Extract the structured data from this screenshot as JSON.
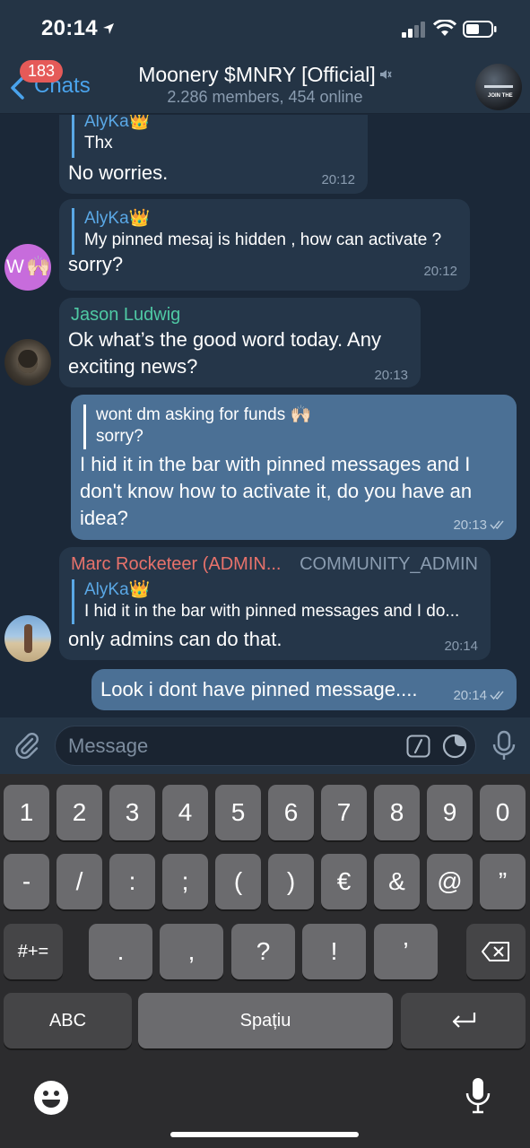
{
  "status_bar": {
    "time": "20:14"
  },
  "header": {
    "back_label": "Chats",
    "unread_count": "183",
    "title": "Moonery $MNRY [Official]",
    "subtitle": "2.286 members, 454 online",
    "avatar_text": "JOIN THE"
  },
  "messages": [
    {
      "reply_name": "AlyKa👑",
      "reply_text": "Thx",
      "text": "No worries.",
      "time": "20:12"
    },
    {
      "reply_name": "AlyKa👑",
      "reply_text": "My pinned mesaj is hidden , how can activate ?",
      "text": "sorry?",
      "time": "20:12",
      "avatar_letter": "W",
      "avatar_emoji": "🙌🏻"
    },
    {
      "sender": "Jason Ludwig",
      "sender_color": "#4fc9a4",
      "text": "Ok what’s the good word today. Any exciting news?",
      "time": "20:13"
    },
    {
      "reply_name": "wont dm asking for funds 🙌🏻",
      "reply_text": "sorry?",
      "text": "I hid it in the bar with pinned messages and I don't know how to activate it, do you have an idea?",
      "time": "20:13",
      "outgoing": true
    },
    {
      "sender": "Marc Rocketeer (ADMIN...",
      "sender_color": "#e8726b",
      "role": "COMMUNITY_ADMIN",
      "reply_name": "AlyKa👑",
      "reply_text": "I hid it in the bar with pinned messages and I do...",
      "text": "only admins can do that.",
      "time": "20:14"
    },
    {
      "text": "Look i dont have pinned message....",
      "time": "20:14",
      "outgoing": true
    }
  ],
  "composer": {
    "placeholder": "Message"
  },
  "keyboard": {
    "row1": [
      "1",
      "2",
      "3",
      "4",
      "5",
      "6",
      "7",
      "8",
      "9",
      "0"
    ],
    "row2": [
      "-",
      "/",
      ":",
      ";",
      "(",
      ")",
      "€",
      "&",
      "@",
      "”"
    ],
    "row3_left": "#+=",
    "row3": [
      ".",
      ",",
      "?",
      "!",
      "’"
    ],
    "abc": "ABC",
    "space": "Spațiu"
  }
}
